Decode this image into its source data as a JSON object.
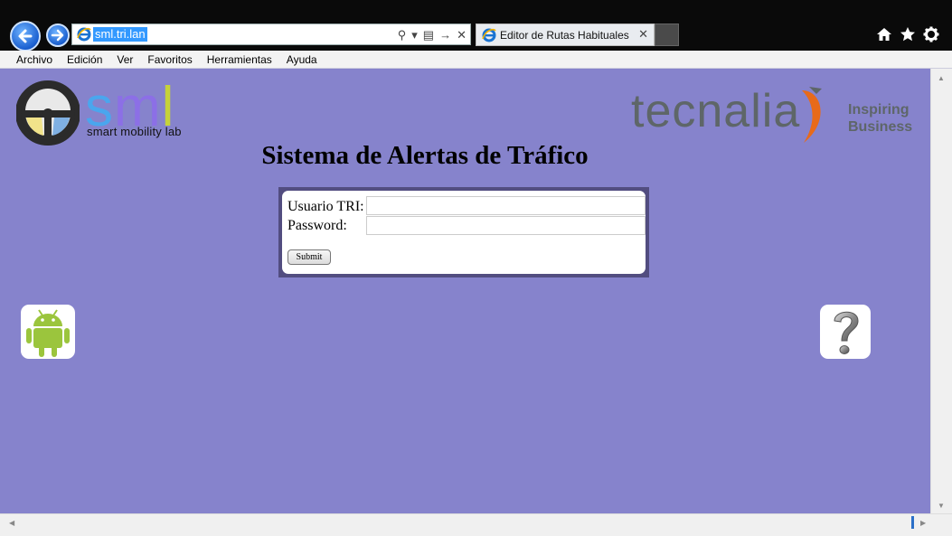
{
  "browser": {
    "url": "sml.tri.lan",
    "tab_title": "Editor de Rutas Habituales",
    "tab_close": "✕"
  },
  "menu": {
    "items": [
      "Archivo",
      "Edición",
      "Ver",
      "Favoritos",
      "Herramientas",
      "Ayuda"
    ]
  },
  "page": {
    "title": "Sistema de Alertas de Tráfico",
    "sml_logo": {
      "letters": "sml",
      "tagline": "smart mobility lab"
    },
    "tecnalia_logo": {
      "word": "tecnalia",
      "tagline_line1": "Inspiring",
      "tagline_line2": "Business"
    },
    "form": {
      "user_label": "Usuario TRI:",
      "password_label": "Password:",
      "user_value": "",
      "password_value": "",
      "submit_label": "Submit"
    },
    "icons": {
      "left": "android-icon",
      "right": "help-question-icon"
    }
  },
  "colors": {
    "page_background": "#8683cc",
    "login_frame": "#524d80",
    "url_highlight": "#3399ff"
  }
}
